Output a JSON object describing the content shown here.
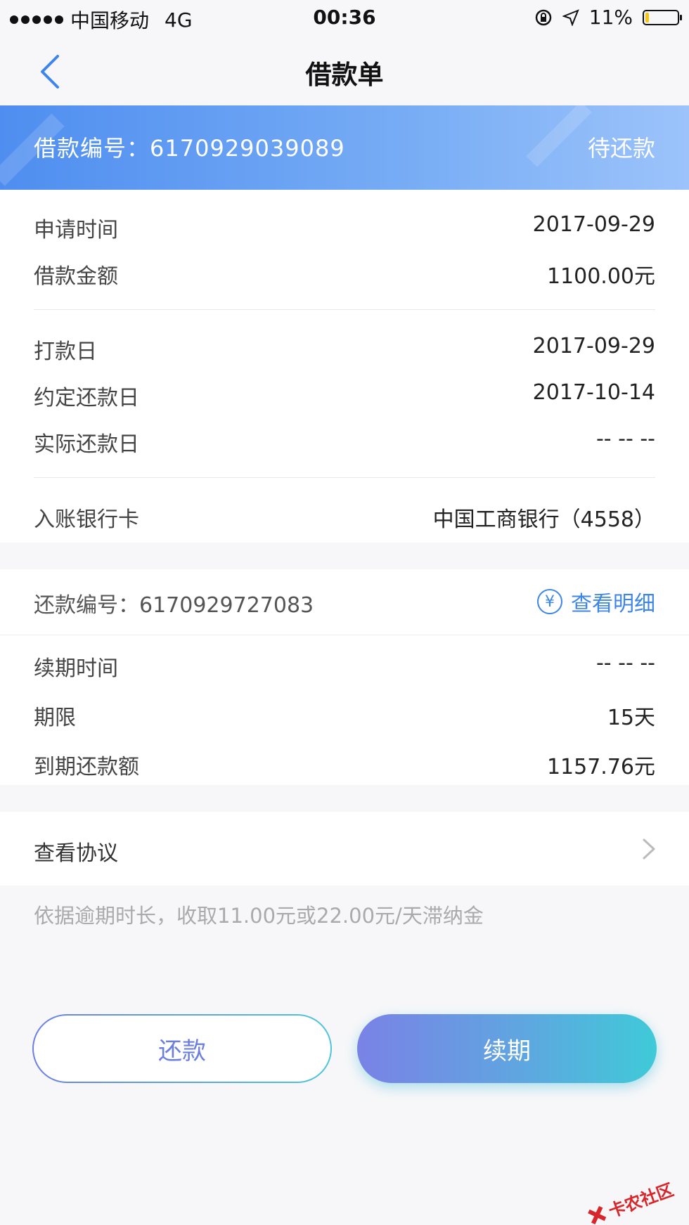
{
  "status_bar": {
    "carrier": "中国移动",
    "network": "4G",
    "time": "00:36",
    "battery": "11%",
    "battery_level": 0.11
  },
  "nav": {
    "title": "借款单",
    "back_icon": "chevron-left-icon"
  },
  "loan": {
    "number_label": "借款编号：",
    "number": "6170929039089",
    "status": "待还款"
  },
  "details": {
    "apply_time": {
      "label": "申请时间",
      "value": "2017-09-29"
    },
    "amount": {
      "label": "借款金额",
      "value": "1100.00元"
    },
    "pay_date": {
      "label": "打款日",
      "value": "2017-09-29"
    },
    "due_date": {
      "label": "约定还款日",
      "value": "2017-10-14"
    },
    "actual_repay_date": {
      "label": "实际还款日",
      "value": "-- -- --"
    },
    "bank_card": {
      "label": "入账银行卡",
      "value": "中国工商银行（4558）"
    }
  },
  "repayment": {
    "number_label": "还款编号：",
    "number": "6170929727083",
    "detail_link": "查看明细",
    "yen_symbol": "¥",
    "renewal_time": {
      "label": "续期时间",
      "value": "-- -- --"
    },
    "term": {
      "label": "期限",
      "value": "15天"
    },
    "due_amount": {
      "label": "到期还款额",
      "value": "1157.76元"
    }
  },
  "agreement": {
    "label": "查看协议"
  },
  "note": "依据逾期时长，收取11.00元或22.00元/天滞纳金",
  "buttons": {
    "repay": "还款",
    "renew": "续期"
  },
  "watermark": "卡农社区",
  "colors": {
    "accent": "#3d86e8",
    "banner_start": "#4f8ef0",
    "banner_end": "#9cc3fa",
    "battery": "#f5c518"
  }
}
